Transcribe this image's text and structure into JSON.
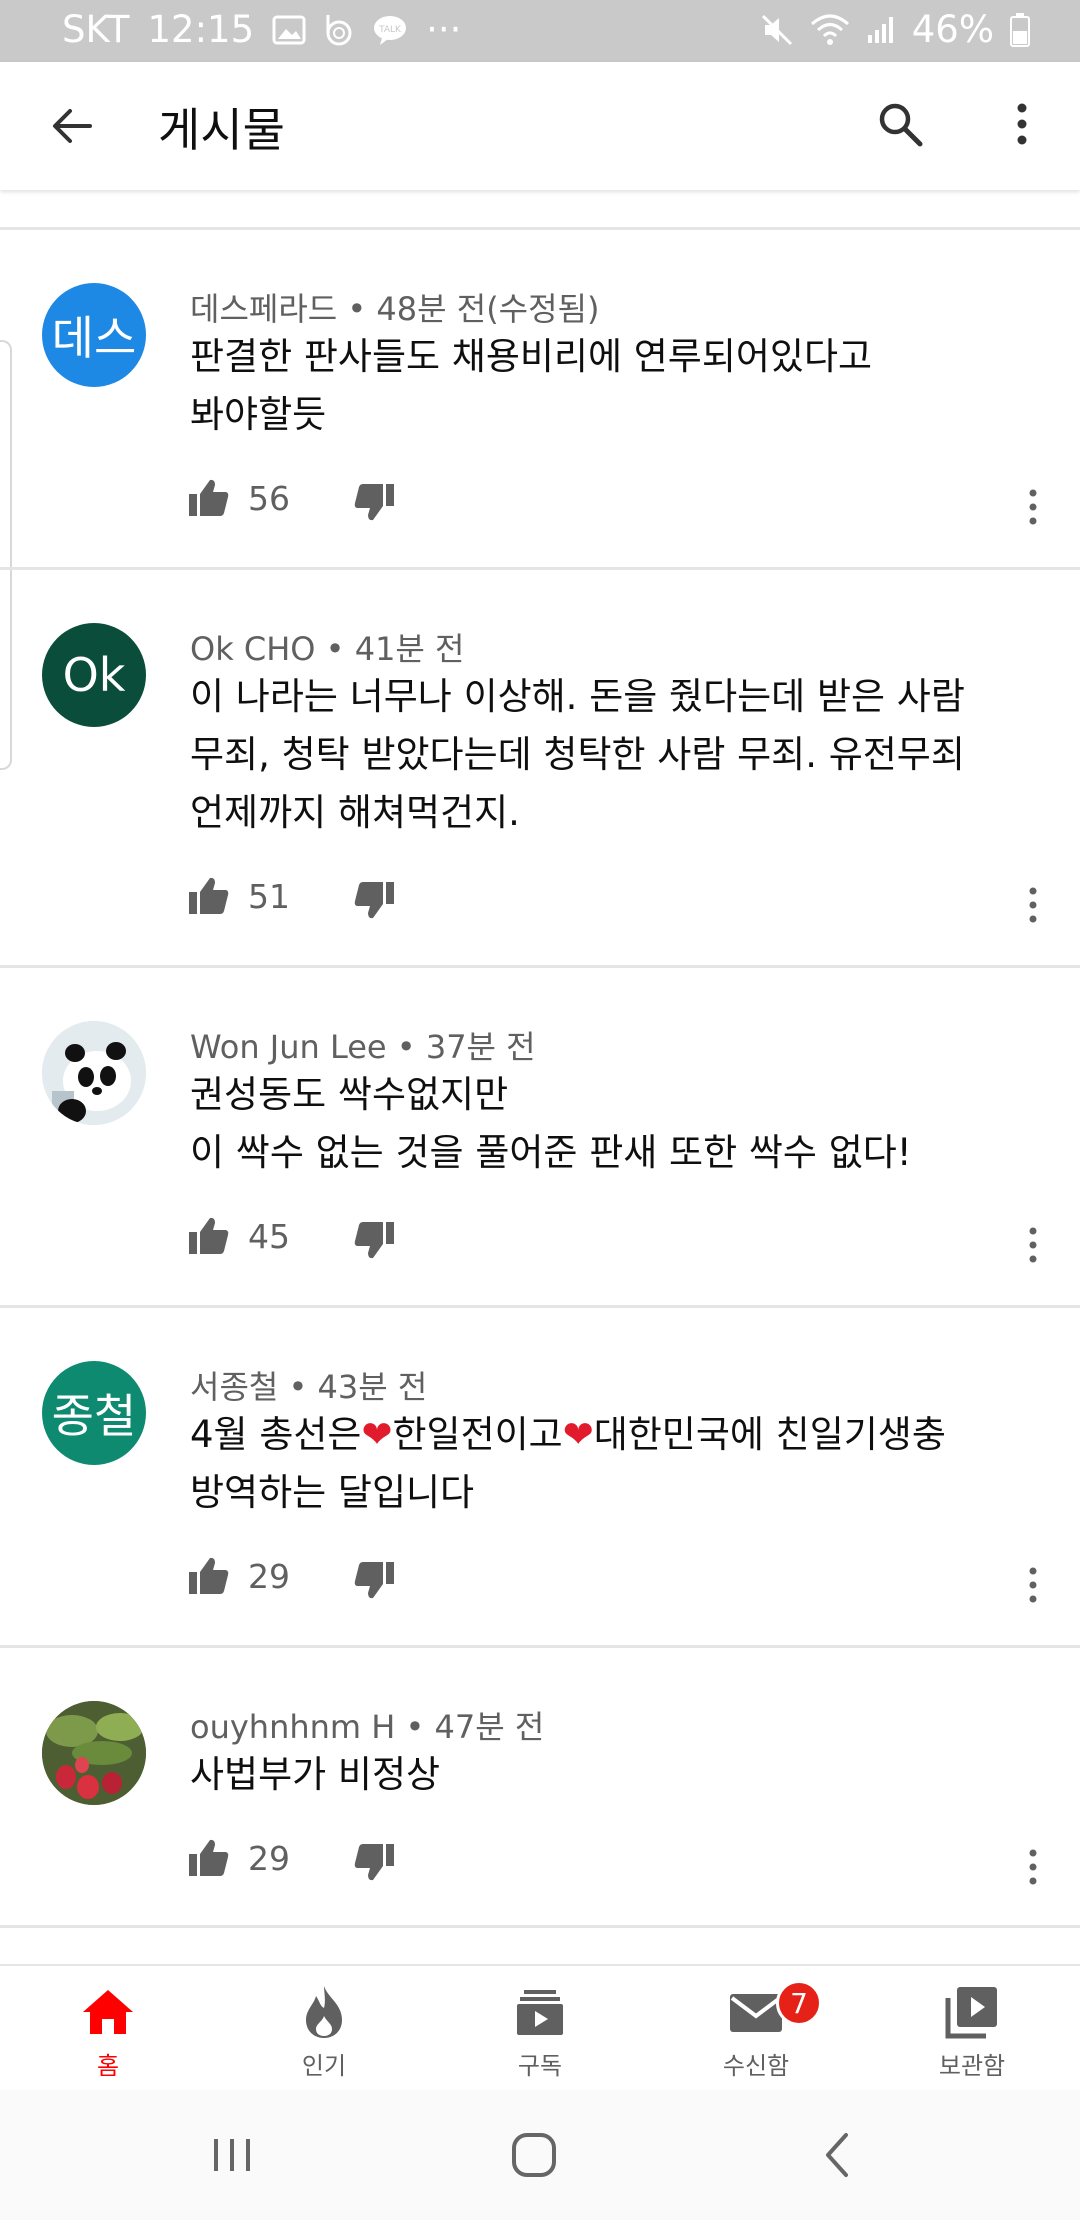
{
  "status_bar": {
    "carrier": "SKT",
    "time": "12:15",
    "overflow": "···",
    "battery": "46%",
    "icons": [
      "gallery-icon",
      "b-app-icon",
      "talk-icon",
      "mute-icon",
      "wifi-icon",
      "signal-icon",
      "battery-icon"
    ]
  },
  "app_bar": {
    "title": "게시물",
    "icons": [
      "back-arrow-icon",
      "search-icon",
      "more-vert-icon"
    ]
  },
  "comments": [
    {
      "avatar_text": "데스",
      "avatar_color": "#1e88e5",
      "author": "데스페라드",
      "time": "48분 전(수정됨)",
      "lines": [
        "판결한 판사들도 채용비리에 연루되어있다고",
        "봐야할듯"
      ],
      "likes": "56"
    },
    {
      "avatar_text": "Ok",
      "avatar_color": "#0b4d3b",
      "author": "Ok CHO",
      "time": "41분 전",
      "lines": [
        "이 나라는 너무나 이상해. 돈을 줬다는데 받은 사람",
        "무죄, 청탁 받았다는데 청탁한 사람 무죄. 유전무죄",
        "언제까지 해쳐먹건지."
      ],
      "likes": "51"
    },
    {
      "avatar_text": "",
      "avatar_color": "#dfe6ea",
      "author": "Won Jun Lee",
      "time": "37분 전",
      "lines": [
        "권성동도 싹수없지만",
        "이 싹수 없는 것을 풀어준 판새 또한 싹수 없다!"
      ],
      "likes": "45"
    },
    {
      "avatar_text": "종철",
      "avatar_color": "#0d8a6f",
      "author": "서종철",
      "time": "43분 전",
      "line1_parts": [
        "4월 총선은",
        "❤",
        "한일전이고",
        "❤",
        "대한민국에 친일기생충"
      ],
      "lines": [
        "방역하는 달입니다"
      ],
      "likes": "29"
    },
    {
      "avatar_text": "",
      "avatar_color": "#5b6b3a",
      "author": "ouyhnhnm H",
      "time": "47분 전",
      "lines": [
        "사법부가 비정상"
      ],
      "likes": "29"
    }
  ],
  "meta_separator": "•",
  "bottom_nav": {
    "items": [
      {
        "label": "홈",
        "icon": "home-icon",
        "active": true
      },
      {
        "label": "인기",
        "icon": "trending-flame-icon",
        "active": false
      },
      {
        "label": "구독",
        "icon": "subscriptions-icon",
        "active": false
      },
      {
        "label": "수신함",
        "icon": "inbox-mail-icon",
        "active": false
      },
      {
        "label": "보관함",
        "icon": "library-icon",
        "active": false
      }
    ],
    "inbox_badge": "7",
    "active_color": "#ff0000"
  },
  "system_nav": {
    "icons": [
      "recents-icon",
      "home-circle-icon",
      "back-chevron-icon"
    ]
  }
}
